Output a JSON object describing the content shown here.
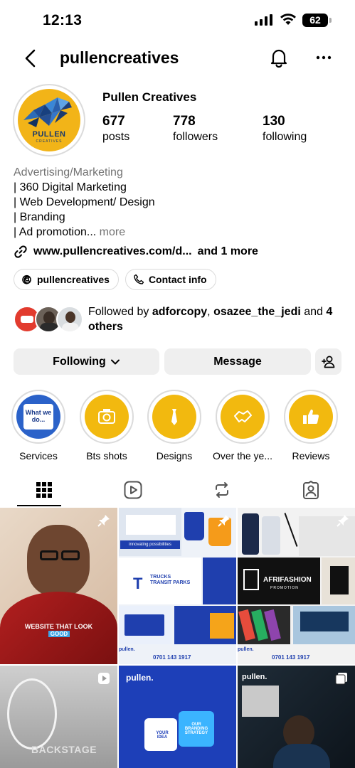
{
  "status_bar": {
    "time": "12:13",
    "battery": "62"
  },
  "header": {
    "username": "pullencreatives"
  },
  "profile": {
    "display_name": "Pullen Creatives",
    "avatar_brand": "PULLEN",
    "avatar_sub": "CREATIVES",
    "stats": [
      {
        "value": "677",
        "label": "posts"
      },
      {
        "value": "778",
        "label": "followers"
      },
      {
        "value": "130",
        "label": "following"
      }
    ]
  },
  "bio": {
    "category": "Advertising/Marketing",
    "lines": [
      "| 360 Digital Marketing",
      "| Web Development/ Design",
      "| Branding",
      "| Ad promotion..."
    ],
    "more": "more",
    "link": "www.pullencreatives.com/d...",
    "link_more": "and 1 more"
  },
  "chips": {
    "threads": "pullencreatives",
    "contact": "Contact info"
  },
  "followed_by": {
    "prefix": "Followed by",
    "user1": "adforcopy",
    "user2": "osazee_the_jedi",
    "and": "and",
    "others": "4 others"
  },
  "buttons": {
    "following": "Following",
    "message": "Message"
  },
  "highlights": [
    {
      "label": "Services",
      "text": "What we do..."
    },
    {
      "label": "Bts shots"
    },
    {
      "label": "Designs"
    },
    {
      "label": "Over the ye..."
    },
    {
      "label": "Reviews"
    }
  ],
  "grid": {
    "post1_caption_a": "WEBSITE THAT LOOK",
    "post1_caption_b": "GOOD",
    "phone": "0701 143 1917",
    "brand_small": "pullen.",
    "trucks": "TRUCKS TRANSIT PARKS",
    "afrifashion": "AFRIFASHION",
    "afri_sub": "PROMOTION",
    "backstage": "BACKSTAGE",
    "puzzle_a": "YOUR IDEA",
    "puzzle_b": "OUR BRANDING STRATEGY",
    "slogan": "innovating possibilities"
  }
}
